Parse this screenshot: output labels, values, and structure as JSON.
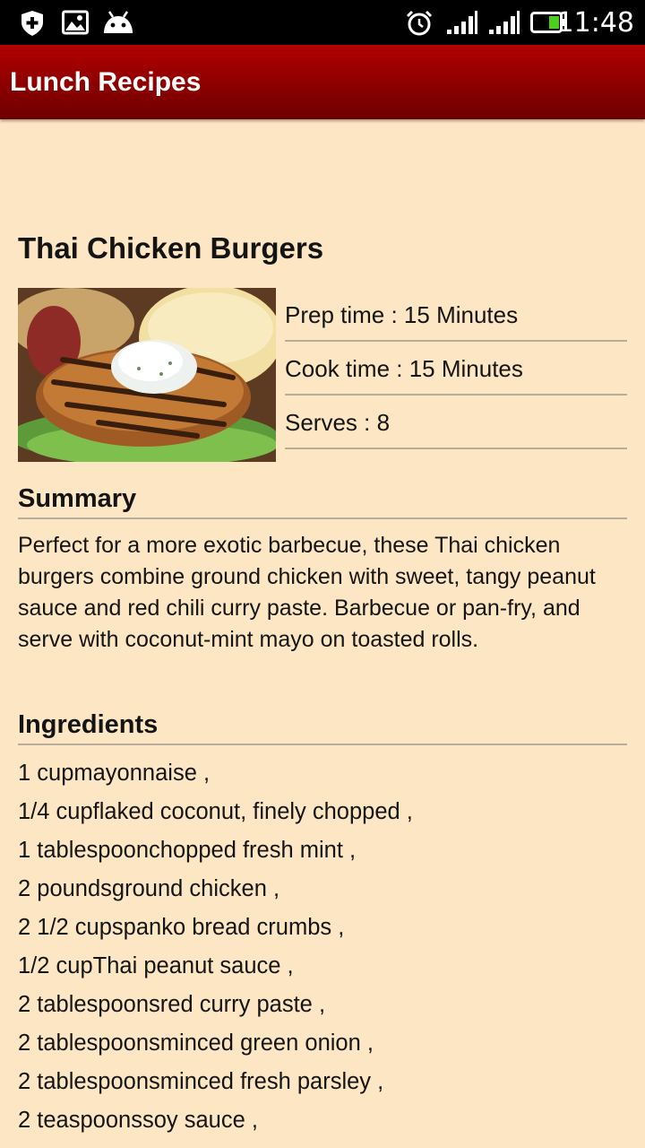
{
  "status_bar": {
    "time": "11:48",
    "icons": [
      "shield-plus-icon",
      "gallery-icon",
      "android-icon",
      "alarm-icon",
      "signal-icon",
      "signal-icon",
      "battery-icon"
    ]
  },
  "app_bar": {
    "title": "Lunch Recipes"
  },
  "recipe": {
    "title": "Thai Chicken Burgers",
    "prep_time": "Prep time : 15 Minutes",
    "cook_time": "Cook time : 15 Minutes",
    "serves": "Serves : 8",
    "summary_heading": "Summary",
    "summary": "Perfect for a more exotic barbecue, these Thai chicken burgers combine ground chicken with sweet, tangy peanut sauce and red chili curry paste. Barbecue or pan-fry, and serve with coconut-mint mayo on toasted rolls.",
    "ingredients_heading": "Ingredients",
    "ingredients": [
      "1 cupmayonnaise ,",
      "1/4 cupflaked coconut, finely chopped ,",
      "1 tablespoonchopped fresh mint ,",
      "2 poundsground chicken ,",
      "2 1/2 cupspanko bread crumbs ,",
      "1/2 cupThai peanut sauce ,",
      "2 tablespoonsred curry paste ,",
      "2 tablespoonsminced green onion ,",
      "2 tablespoonsminced fresh parsley ,",
      "2 teaspoonssoy sauce ,"
    ]
  },
  "colors": {
    "background": "#fde6c4",
    "app_bar_top": "#b10000",
    "app_bar_bottom": "#6e0000",
    "divider": "#b8ad9c"
  }
}
